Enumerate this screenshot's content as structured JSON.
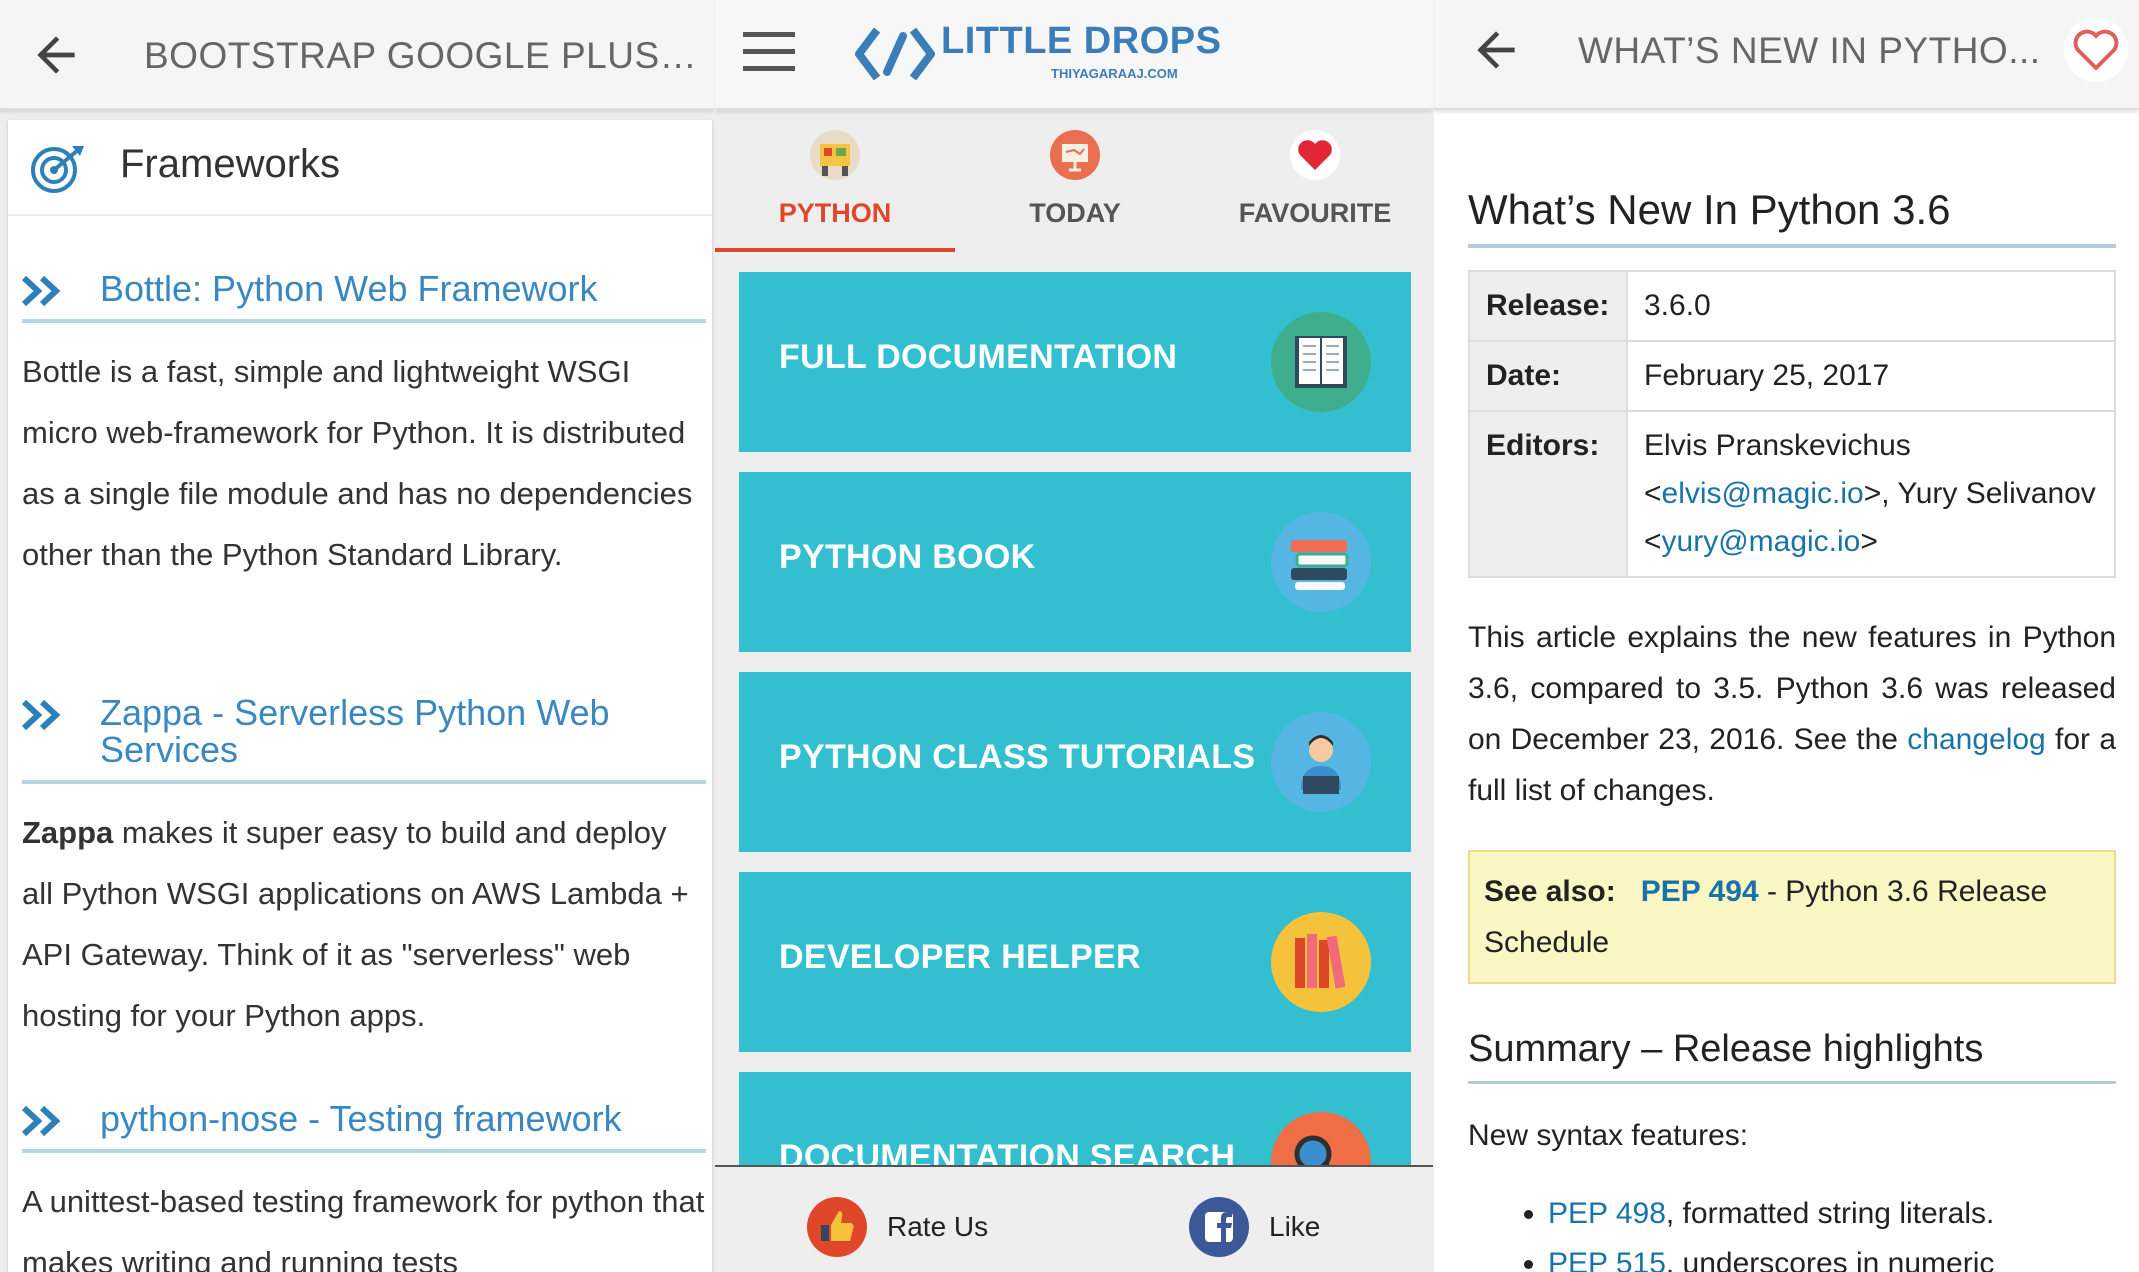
{
  "left": {
    "title": "BOOTSTRAP GOOGLE PLUS T...",
    "card_title": "Frameworks",
    "sections": [
      {
        "title": "Bottle: Python Web Framework",
        "text": "Bottle is a fast, simple and lightweight WSGI micro web-framework for Python. It is distributed as a single file module and has no dependencies other than the Python Standard Library."
      },
      {
        "title": "Zappa - Serverless Python Web Services",
        "bold": "Zappa",
        "text": " makes it super easy to build and deploy all Python WSGI applications on AWS Lambda + API Gateway. Think of it as \"serverless\" web hosting for your Python apps."
      },
      {
        "title": "python-nose - Testing framework",
        "text": "A unittest-based testing framework for python that makes writing and running tests"
      }
    ]
  },
  "middle": {
    "logo_main": "LITTLE DROPS",
    "logo_sub": "THIYAGARAAJ.COM",
    "tabs": [
      "PYTHON",
      "TODAY",
      "FAVOURITE"
    ],
    "tiles": [
      "FULL DOCUMENTATION",
      "PYTHON BOOK",
      "PYTHON CLASS TUTORIALS",
      "DEVELOPER HELPER",
      "DOCUMENTATION SEARCH"
    ],
    "bottom": {
      "rate": "Rate Us",
      "like": "Like"
    },
    "colors": {
      "accent": "#e0472a",
      "tile": "#34bfd0"
    }
  },
  "right": {
    "title": "WHAT’S NEW IN PYTHO...",
    "heading": "What’s New In Python 3.6",
    "meta": {
      "release_key": "Release:",
      "release_val": "3.6.0",
      "date_key": "Date:",
      "date_val": "February 25, 2017",
      "editors_key": "Editors:",
      "ed1": "Elvis Pranskevichus <",
      "ed1_mail": "elvis@magic.io",
      "ed1_end": ">, Yury Selivanov <",
      "ed2_mail": "yury@magic.io",
      "ed2_end": ">"
    },
    "intro": "This article explains the new features in Python 3.6, compared to 3.5. Python 3.6 was released on December 23, 2016.  See the ",
    "intro_link": "changelog",
    "intro_end": " for a full list of changes.",
    "see_also_label": "See also:",
    "see_also_link": "PEP 494",
    "see_also_text": " - Python 3.6 Release Schedule",
    "summary_heading": "Summary – Release highlights",
    "new_syntax": "New syntax features:",
    "bullets": [
      {
        "link": "PEP 498",
        "text": ", formatted string literals."
      },
      {
        "link": "PEP 515",
        "text": ", underscores in numeric"
      }
    ]
  }
}
